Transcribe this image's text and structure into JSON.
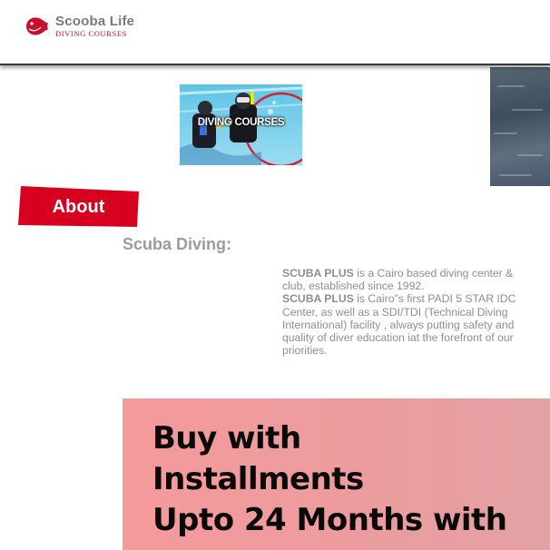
{
  "header": {
    "brand_name": "Scooba Life",
    "brand_tagline": "DIVING COURSES",
    "logo_icon": "fish-icon",
    "brand_color": "#c8102e"
  },
  "course_image": {
    "caption": "DIVING COURSES"
  },
  "about": {
    "tab_label": "About",
    "title": "Scuba Diving:",
    "brand_1": "SCUBA PLUS",
    "text_1": " is a Cairo based diving center & club, established since 1992.",
    "brand_2": "SCUBA PLUS",
    "text_2": " is Cairo\"s first PADI 5 STAR IDC Center, as well as a SDI/TDI (Technical Diving International) facility , always putting safety and quality of diver education iat the forefront of our priorities."
  },
  "promo": {
    "line_1": "Buy with",
    "line_2": "Installments",
    "line_3": "Upto 24 Months with"
  },
  "colors": {
    "accent_red": "#d7001e",
    "promo_bg": "#f59a9b",
    "text_gray": "#8e8e8e"
  }
}
